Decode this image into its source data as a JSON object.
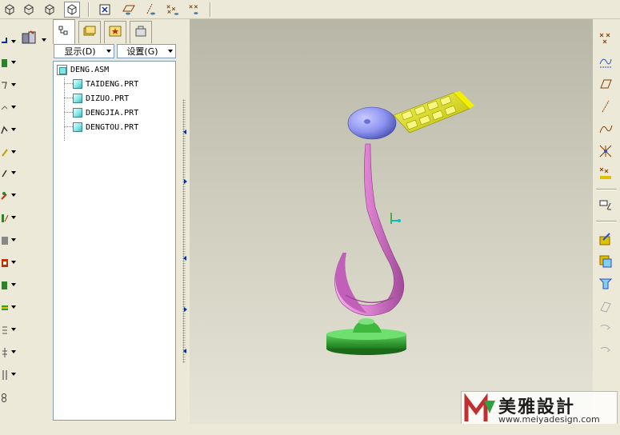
{
  "model_tree": {
    "show_label": "显示(D)",
    "settings_label": "设置(G)",
    "items": [
      {
        "label": "DENG.ASM",
        "type": "assembly"
      },
      {
        "label": "TAIDENG.PRT",
        "type": "part"
      },
      {
        "label": "DIZUO.PRT",
        "type": "part"
      },
      {
        "label": "DENGJIA.PRT",
        "type": "part"
      },
      {
        "label": "DENGTOU.PRT",
        "type": "part"
      }
    ]
  },
  "top_toolbar": {
    "icons": [
      "view-cube-wireframe-icon",
      "view-cube-hidden-icon",
      "view-cube-nohidden-icon",
      "view-cube-shaded-icon",
      "datum-display-toggle-icon",
      "datum-plane-display-icon",
      "datum-axis-display-icon",
      "datum-point-display-icon",
      "coordinate-system-display-icon"
    ]
  },
  "right_toolbar": {
    "icons": [
      "datum-point-icon",
      "sketch-curve-icon",
      "datum-plane-icon",
      "datum-axis-icon",
      "datum-curve-icon",
      "datum-point-tool-icon",
      "coordinate-system-icon",
      "analysis-icon",
      "assembly-component-icon",
      "create-component-icon",
      "pattern-icon",
      "mirror-icon",
      "rotate-icon",
      "rotate-alt-icon"
    ]
  },
  "watermark": {
    "title": "美雅設計",
    "url": "www.meiyadesign.com"
  },
  "colors": {
    "lamp_shade": "#e8e800",
    "lamp_head": "#8e94f0",
    "lamp_arm": "#dc7fd0",
    "lamp_base": "#2faa2f",
    "selection_axis": "#00c0c0"
  }
}
